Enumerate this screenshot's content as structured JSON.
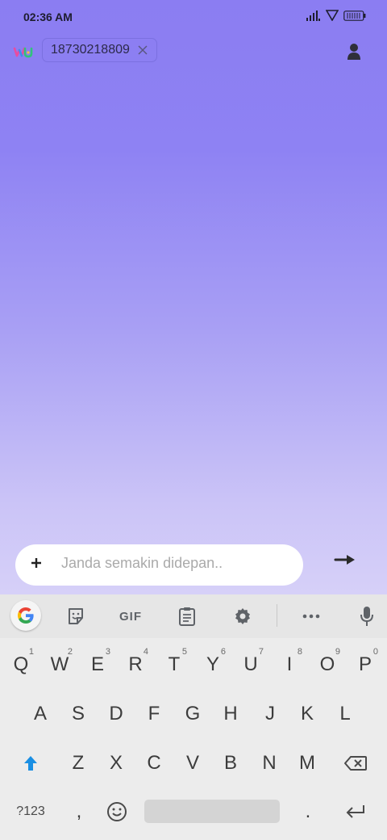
{
  "status_bar": {
    "time": "02:36 AM",
    "icons": [
      "signal-icon",
      "wifi-icon",
      "battery-icon"
    ]
  },
  "header": {
    "logo": "wu-logo",
    "recipient_number": "18730218809",
    "clear_icon": "close-icon",
    "profile_icon": "person-icon"
  },
  "composer": {
    "add_icon": "plus-icon",
    "message_placeholder": "Janda semakin didepan..",
    "send_icon": "arrow-right-icon"
  },
  "keyboard": {
    "toolbar": {
      "gif_label": "GIF",
      "items": [
        "google-icon",
        "sticker-icon",
        "gif",
        "clipboard-icon",
        "settings-icon",
        "more-icon",
        "mic-icon"
      ]
    },
    "row1": [
      {
        "k": "Q",
        "h": "1"
      },
      {
        "k": "W",
        "h": "2"
      },
      {
        "k": "E",
        "h": "3"
      },
      {
        "k": "R",
        "h": "4"
      },
      {
        "k": "T",
        "h": "5"
      },
      {
        "k": "Y",
        "h": "6"
      },
      {
        "k": "U",
        "h": "7"
      },
      {
        "k": "I",
        "h": "8"
      },
      {
        "k": "O",
        "h": "9"
      },
      {
        "k": "P",
        "h": "0"
      }
    ],
    "row2": [
      "A",
      "S",
      "D",
      "F",
      "G",
      "H",
      "J",
      "K",
      "L"
    ],
    "row3": [
      "Z",
      "X",
      "C",
      "V",
      "B",
      "N",
      "M"
    ],
    "row4": {
      "symbols_label": "?123",
      "comma_label": ",",
      "period_label": "."
    },
    "accent_color": "#1a8fe3"
  },
  "colors": {
    "gradient_top": "#8b7df2",
    "gradient_bottom": "#d6d0f8",
    "keyboard_bg": "#ececec"
  }
}
